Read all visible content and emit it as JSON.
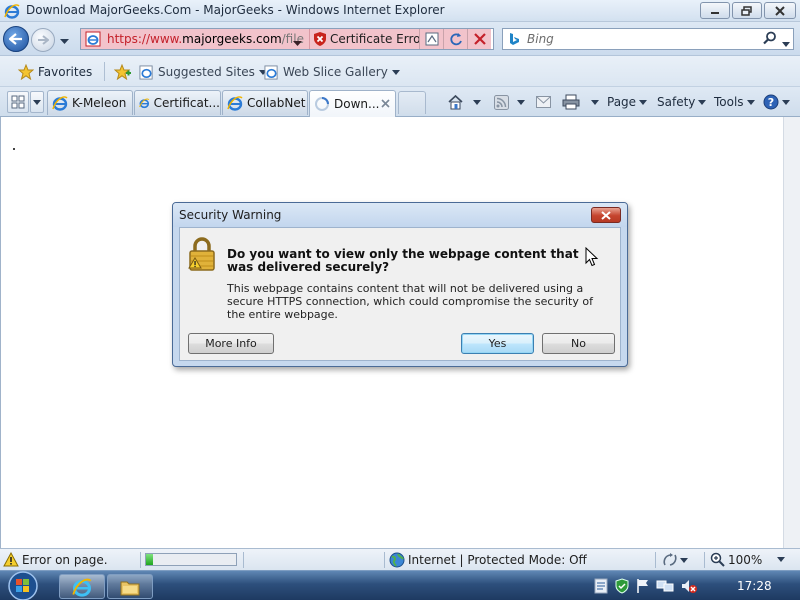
{
  "window": {
    "title": "Download MajorGeeks.Com - MajorGeeks - Windows Internet Explorer"
  },
  "address_bar": {
    "url_scheme": "https://www.",
    "url_host": "majorgeeks.com",
    "url_path": "/file",
    "certificate_label": "Certificate Error"
  },
  "search": {
    "placeholder": "Bing"
  },
  "favorites_bar": {
    "favorites_label": "Favorites",
    "items": [
      "Suggested Sites",
      "Web Slice Gallery"
    ]
  },
  "tabs": [
    {
      "label": "K-Meleon",
      "active": false
    },
    {
      "label": "Certificat...",
      "active": false
    },
    {
      "label": "CollabNet",
      "active": false
    },
    {
      "label": "Down...",
      "active": true
    }
  ],
  "command_bar": {
    "page_label": "Page",
    "safety_label": "Safety",
    "tools_label": "Tools"
  },
  "dialog": {
    "title": "Security Warning",
    "question": "Do you want to view only the webpage content that was delivered securely?",
    "detail": "This webpage contains content that will not be delivered using a secure HTTPS connection, which could compromise the security of the entire webpage.",
    "more_info_label": "More Info",
    "yes_label": "Yes",
    "no_label": "No"
  },
  "status_bar": {
    "error_text": "Error on page.",
    "progress": 0.08,
    "zone_text": "Internet | Protected Mode: Off",
    "zoom_text": "100%"
  },
  "taskbar": {
    "clock": "17:28"
  },
  "colors": {
    "cert_error_bg": "#f2c3cb",
    "dialog_frame": "#c6d8ee",
    "taskbar": "#2d4f7c"
  }
}
